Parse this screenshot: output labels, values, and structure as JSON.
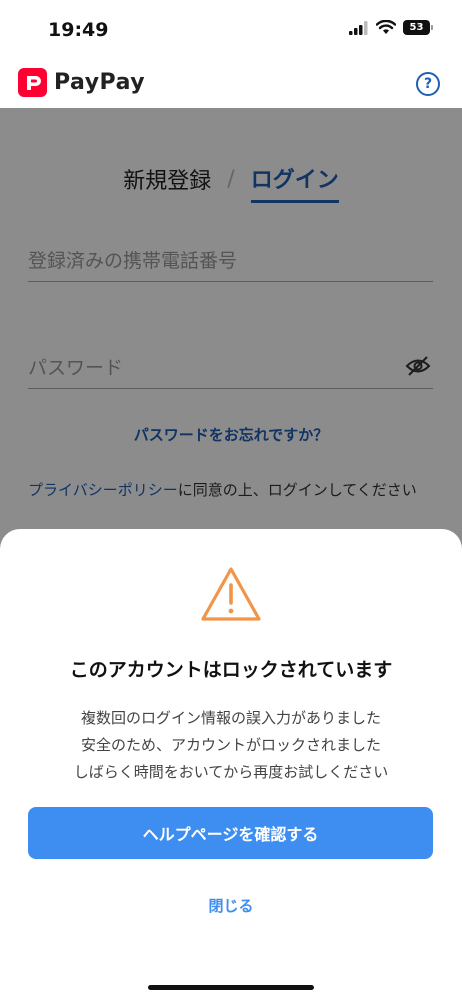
{
  "status_bar": {
    "time": "19:49",
    "battery": "53"
  },
  "header": {
    "logo_text": "PayPay",
    "help_icon": "help-circle-icon",
    "help_label": "?"
  },
  "tabs": {
    "register": "新規登録",
    "separator": "/",
    "login": "ログイン"
  },
  "form": {
    "phone_placeholder": "登録済みの携帯電話番号",
    "password_placeholder": "パスワード",
    "forgot_password": "パスワードをお忘れですか？",
    "privacy_link": "プライバシーポリシー",
    "privacy_text": "に同意の上、ログインしてください"
  },
  "dialog": {
    "icon": "warning-icon",
    "title": "このアカウントはロックされています",
    "message_lines": [
      "複数回のログイン情報の誤入力がありました",
      "安全のため、アカウントがロックされました",
      "しばらく時間をおいてから再度お試しください"
    ],
    "primary_button": "ヘルプページを確認する",
    "close_button": "閉じる"
  },
  "colors": {
    "brand_red": "#ff0033",
    "link_blue": "#1f5fb5",
    "button_blue": "#3d8ef0",
    "warning_orange": "#f0954a"
  }
}
